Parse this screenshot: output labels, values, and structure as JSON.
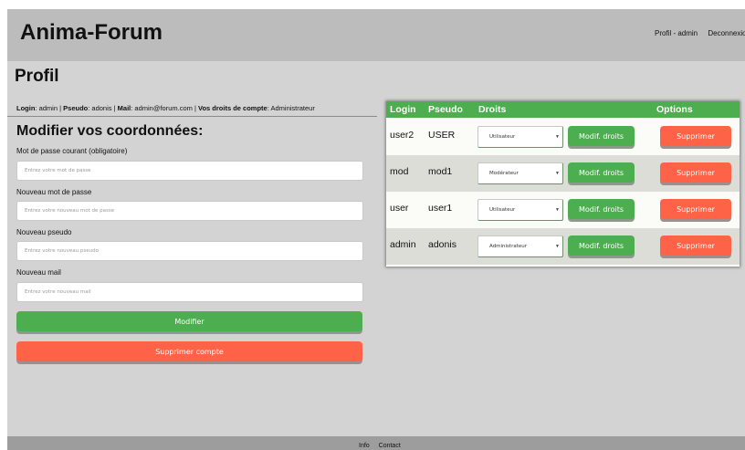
{
  "header": {
    "site_title": "Anima-Forum",
    "nav": {
      "profile": "Profil - admin",
      "logout": "Deconnexion"
    }
  },
  "page": {
    "title": "Profil",
    "info": {
      "login_label": "Login",
      "login_value": "admin",
      "pseudo_label": "Pseudo",
      "pseudo_value": "adonis",
      "mail_label": "Mail",
      "mail_value": "admin@forum.com",
      "rights_label": "Vos droits de compte",
      "rights_value": "Administrateur"
    }
  },
  "form": {
    "title": "Modifier vos coordonnées:",
    "current_password": {
      "label": "Mot de passe courant (obligatoire)",
      "value": "",
      "placeholder": "Entrez votre mot de passe"
    },
    "new_password": {
      "label": "Nouveau mot de passe",
      "value": "",
      "placeholder": "Entrez votre nouveau mot de passe"
    },
    "new_pseudo": {
      "label": "Nouveau pseudo",
      "value": "",
      "placeholder": "Entrez votre nouveau pseudo"
    },
    "new_mail": {
      "label": "Nouveau mail",
      "value": "",
      "placeholder": "Entrez votre nouveau mail"
    },
    "submit_label": "Modifier",
    "delete_account_label": "Supprimer compte"
  },
  "users_table": {
    "headers": {
      "login": "Login",
      "pseudo": "Pseudo",
      "rights": "Droits",
      "options": "Options"
    },
    "modify_label": "Modif. droits",
    "delete_label": "Supprimer",
    "rows": [
      {
        "login": "user2",
        "pseudo": "USER",
        "role": "Utilisateur"
      },
      {
        "login": "mod",
        "pseudo": "mod1",
        "role": "Modérateur"
      },
      {
        "login": "user",
        "pseudo": "user1",
        "role": "Utilisateur"
      },
      {
        "login": "admin",
        "pseudo": "adonis",
        "role": "Administrateur"
      }
    ]
  },
  "footer": {
    "info": "Info",
    "contact": "Contact"
  },
  "colors": {
    "header_bg": "#bcbcbc",
    "page_bg": "#d3d3d3",
    "accent_green": "#4cae4f",
    "danger_red": "#fe6347",
    "footer_bg": "#9d9d9d"
  }
}
